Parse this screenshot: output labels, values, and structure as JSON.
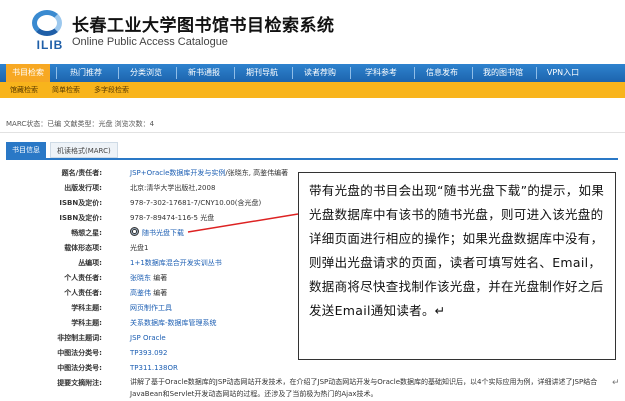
{
  "header": {
    "logo_text": "ILIB",
    "title_cn": "长春工业大学图书馆书目检索系统",
    "title_en": "Online Public Access Catalogue"
  },
  "nav": {
    "items": [
      "书目检索",
      "热门推荐",
      "分类浏览",
      "新书通报",
      "期刊导航",
      "读者荐购",
      "学科参考",
      "信息发布",
      "我的图书馆",
      "VPN入口"
    ],
    "active_index": 0
  },
  "subnav": {
    "items": [
      "馆藏检索",
      "简单检索",
      "多字段检索"
    ]
  },
  "marc_status": "MARC状态：已编  文献类型：光盘  浏览次数：4",
  "tabs": [
    "书目信息",
    "机读格式(MARC)"
  ],
  "detail": [
    {
      "label": "题名/责任者:",
      "value": "JSP+Oracle数据库开发与实例",
      "extra": "/张晓东, 高鉴伟编著",
      "link": true
    },
    {
      "label": "出版发行项:",
      "value": "北京:清华大学出版社,2008",
      "link": false
    },
    {
      "label": "ISBN及定价:",
      "value": "978-7-302-17681-7/CNY10.00(含光盘)",
      "link": false
    },
    {
      "label": "ISBN及定价:",
      "value": "978-7-89474-116-5 光盘",
      "link": false
    },
    {
      "label": "畅想之星:",
      "value": "随书光盘下载",
      "link": true,
      "icon": "cd-icon"
    },
    {
      "label": "载体形态项:",
      "value": "光盘1",
      "link": false
    },
    {
      "label": "丛编项:",
      "value": "1+1数据库混合开发实训丛书",
      "link": true
    },
    {
      "label": "个人责任者:",
      "value": "张晓东",
      "extra": " 编著",
      "link": true
    },
    {
      "label": "个人责任者:",
      "value": "高鉴伟",
      "extra": " 编著",
      "link": true
    },
    {
      "label": "学科主题:",
      "value": "网页制作工具",
      "link": true
    },
    {
      "label": "学科主题:",
      "value": "关系数据库-数据库管理系统",
      "link": true
    },
    {
      "label": "非控制主题词:",
      "value": "JSP Oracle",
      "link": true
    },
    {
      "label": "中图法分类号:",
      "value": "TP393.092",
      "link": true
    },
    {
      "label": "中图法分类号:",
      "value": "TP311.138OR",
      "link": true
    },
    {
      "label": "提要文摘附注:",
      "value": "讲解了基于Oracle数据库的JSP动态网站开发技术，在介绍了JSP动态网站开发与Oracle数据库的基础知识后，以4个实际应用为例，详细讲述了JSP结合JavaBean和Servlet开发动态网站的过程。还涉及了当前极为热门的Ajax技术。",
      "link": false
    }
  ],
  "callout": {
    "text": "带有光盘的书目会出现“随书光盘下载”的提示，如果光盘数据库中有该书的随书光盘，则可进入该光盘的详细页面进行相应的操作；如果光盘数据库中没有，则弹出光盘请求的页面，读者可填写姓名、Email，数据商将尽快查找制作该光盘，并在光盘制作好之后发送Email通知读者。↵"
  },
  "paragraph_mark": "↵",
  "colors": {
    "nav_bg": "#2272bb",
    "nav_active": "#f7a823",
    "subnav_bg": "#f8b41c",
    "link": "#1d5fb3",
    "tab_active": "#2a78c6"
  }
}
